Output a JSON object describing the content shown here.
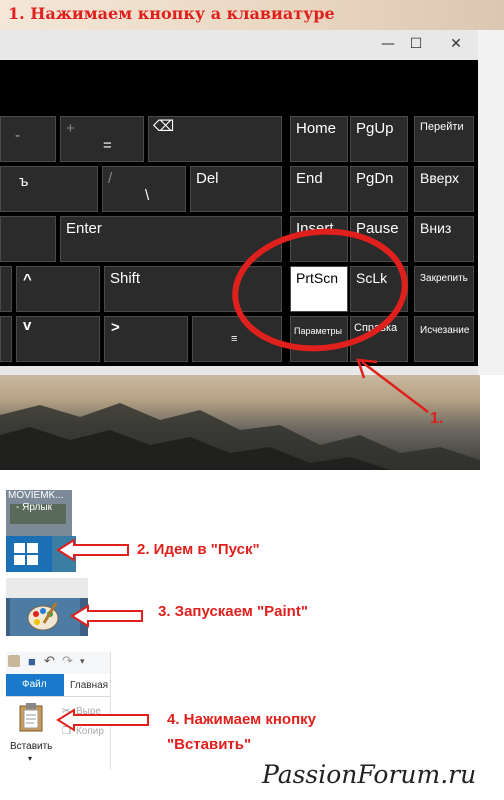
{
  "step1": {
    "title": "1. Нажимаем кнопку а клавиатуре",
    "window_controls": {
      "minimize": "—",
      "maximize": "☐",
      "close": "✕"
    },
    "keys": {
      "minus": "-",
      "plus": "+",
      "equals": "=",
      "backspace_icon": "⌫",
      "hard_sign": "ъ",
      "slash": "/",
      "backslash": "\\",
      "del": "Del",
      "enter": "Enter",
      "up_arrow": "^",
      "shift": "Shift",
      "down_arrow": "v",
      "right_arrow": ">",
      "menu_icon": "≡",
      "home": "Home",
      "pgup": "PgUp",
      "forward": "Перейти",
      "end": "End",
      "pgdn": "PgDn",
      "up": "Вверх",
      "insert": "Insert",
      "pause": "Pause",
      "down": "Вниз",
      "prtscn": "PrtScn",
      "sclk": "ScLk",
      "pin": "Закрепить",
      "options": "Параметры",
      "help": "Справка",
      "fade": "Исчезание"
    },
    "callout": "1."
  },
  "step2": {
    "desktop_icon_label_line1": "MOVIEMK...",
    "desktop_icon_label_line2": "- Ярлык",
    "caption": "2. Идем в \"Пуск\""
  },
  "step3": {
    "caption": "3. Запускаем \"Paint\""
  },
  "step4": {
    "file_tab": "Файл",
    "home_tab": "Главная",
    "paste_label": "Вставить",
    "cut_label": "Выре",
    "copy_label": "Копир",
    "caption_line1": "4. Нажимаем кнопку",
    "caption_line2": "\"Вставить\""
  },
  "watermark": "PassionForum.ru",
  "colors": {
    "accent_red": "#e0201c",
    "key_bg": "#2b2b2b",
    "file_tab_blue": "#1979ca",
    "start_blue": "#1a6fb5"
  }
}
